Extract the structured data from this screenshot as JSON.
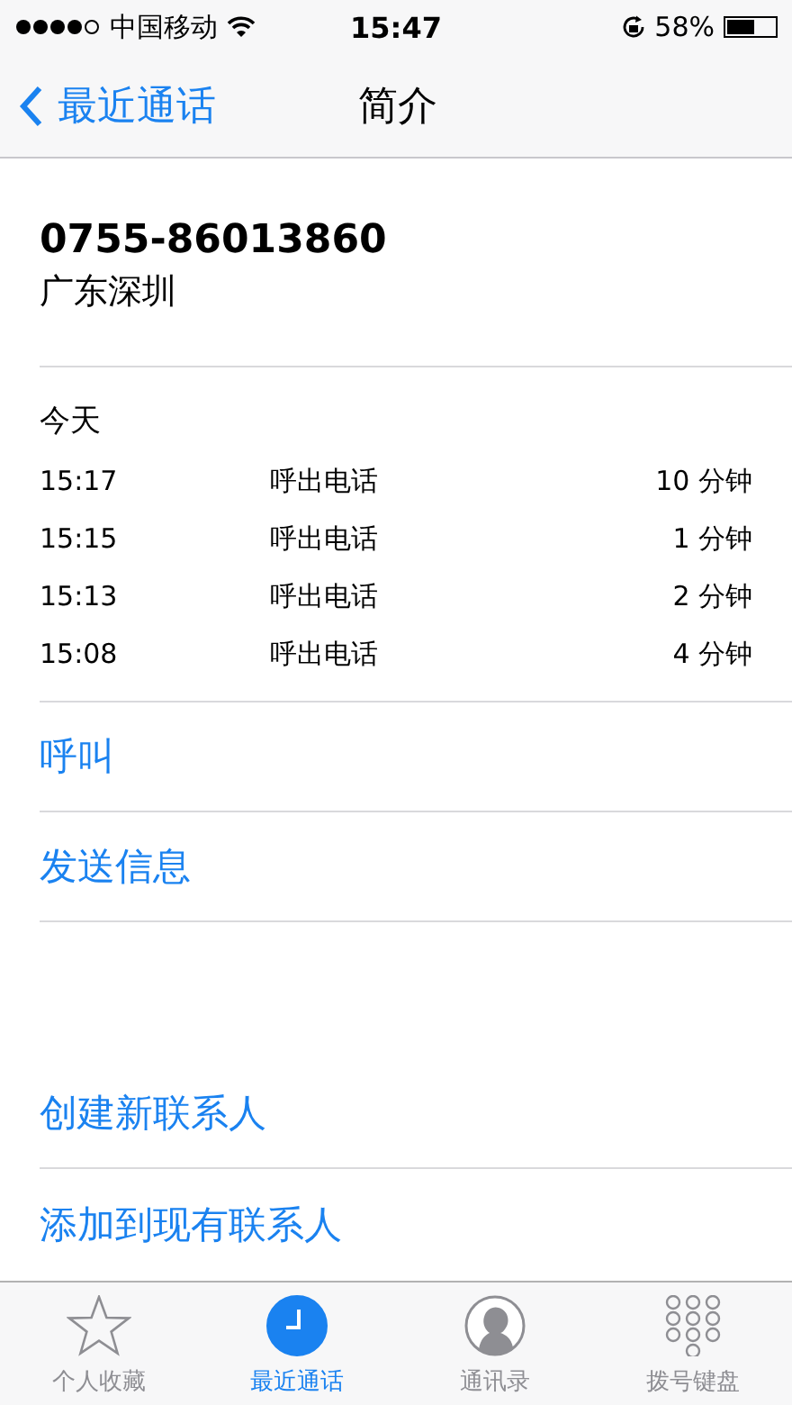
{
  "status_bar": {
    "carrier": "中国移动",
    "time": "15:47",
    "battery_text": "58%"
  },
  "nav": {
    "back": "最近通话",
    "title": "简介"
  },
  "contact": {
    "number": "0755-86013860",
    "location": "广东深圳"
  },
  "history": {
    "day": "今天",
    "rows": [
      {
        "time": "15:17",
        "type": "呼出电话",
        "duration": "10 分钟"
      },
      {
        "time": "15:15",
        "type": "呼出电话",
        "duration": "1 分钟"
      },
      {
        "time": "15:13",
        "type": "呼出电话",
        "duration": "2 分钟"
      },
      {
        "time": "15:08",
        "type": "呼出电话",
        "duration": "4 分钟"
      }
    ]
  },
  "actions": [
    "呼叫",
    "发送信息"
  ],
  "contact_actions": [
    "创建新联系人",
    "添加到现有联系人"
  ],
  "tabs": [
    {
      "label": "个人收藏",
      "kind": "favorites",
      "selected": false
    },
    {
      "label": "最近通话",
      "kind": "recents",
      "selected": true
    },
    {
      "label": "通讯录",
      "kind": "contacts",
      "selected": false
    },
    {
      "label": "拨号键盘",
      "kind": "keypad",
      "selected": false
    }
  ]
}
